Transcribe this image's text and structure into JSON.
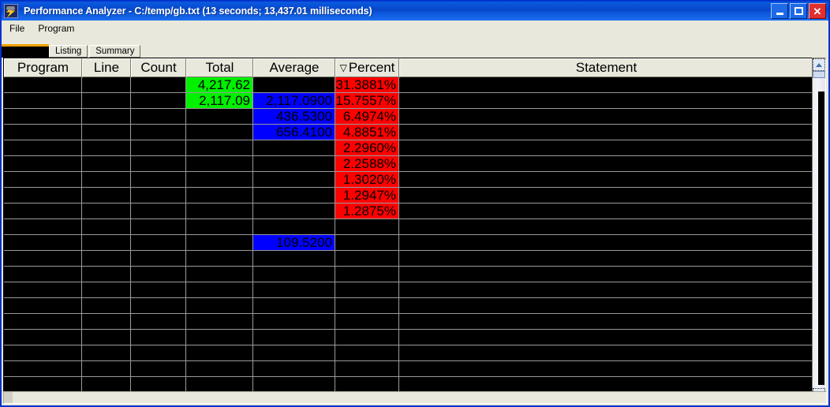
{
  "window": {
    "title": "Performance Analyzer - C:/temp/gb.txt (13 seconds; 13,437.01 milliseconds)",
    "icon": "lightning-bolt-icon",
    "buttons": {
      "minimize": "_",
      "maximize": "□",
      "close": "✕"
    }
  },
  "menu": {
    "items": [
      {
        "label": "File"
      },
      {
        "label": "Program"
      }
    ]
  },
  "tabs": [
    {
      "label": "Listing",
      "selected": false
    },
    {
      "label": "Summary",
      "selected": false
    }
  ],
  "table": {
    "columns": [
      {
        "key": "program",
        "label": "Program",
        "sorted": false
      },
      {
        "key": "line",
        "label": "Line",
        "sorted": false
      },
      {
        "key": "count",
        "label": "Count",
        "sorted": false
      },
      {
        "key": "total",
        "label": "Total",
        "sorted": false
      },
      {
        "key": "average",
        "label": "Average",
        "sorted": false
      },
      {
        "key": "percent",
        "label": "Percent",
        "sorted": true,
        "sort_indicator": "▽"
      },
      {
        "key": "statement",
        "label": "Statement",
        "sorted": false
      }
    ],
    "rows": [
      {
        "program": "",
        "line": "",
        "count": "",
        "total": "4,217.62",
        "total_bg": "#00f000",
        "average": "",
        "average_bg": "#000000",
        "percent": "31.3881%",
        "percent_bg": "#ff0000",
        "statement": ""
      },
      {
        "program": "",
        "line": "",
        "count": "",
        "total": "2,117.09",
        "total_bg": "#00f000",
        "average": "2,117.0900",
        "average_bg": "#0000ff",
        "percent": "15.7557%",
        "percent_bg": "#ff0000",
        "statement": ""
      },
      {
        "program": "",
        "line": "",
        "count": "",
        "total": "",
        "total_bg": "#000000",
        "average": "436.5300",
        "average_bg": "#0000ff",
        "percent": "6.4974%",
        "percent_bg": "#ff0000",
        "statement": ""
      },
      {
        "program": "",
        "line": "",
        "count": "",
        "total": "",
        "total_bg": "#000000",
        "average": "656.4100",
        "average_bg": "#0000ff",
        "percent": "4.8851%",
        "percent_bg": "#ff0000",
        "statement": ""
      },
      {
        "program": "",
        "line": "",
        "count": "",
        "total": "",
        "total_bg": "#000000",
        "average": "",
        "average_bg": "#000000",
        "percent": "2.2960%",
        "percent_bg": "#ff0000",
        "statement": ""
      },
      {
        "program": "",
        "line": "",
        "count": "",
        "total": "",
        "total_bg": "#000000",
        "average": "",
        "average_bg": "#000000",
        "percent": "2.2588%",
        "percent_bg": "#ff0000",
        "statement": ""
      },
      {
        "program": "",
        "line": "",
        "count": "",
        "total": "",
        "total_bg": "#000000",
        "average": "",
        "average_bg": "#000000",
        "percent": "1.3020%",
        "percent_bg": "#ff0000",
        "statement": ""
      },
      {
        "program": "",
        "line": "",
        "count": "",
        "total": "",
        "total_bg": "#000000",
        "average": "",
        "average_bg": "#000000",
        "percent": "1.2947%",
        "percent_bg": "#ff0000",
        "statement": ""
      },
      {
        "program": "",
        "line": "",
        "count": "",
        "total": "",
        "total_bg": "#000000",
        "average": "",
        "average_bg": "#000000",
        "percent": "1.2875%",
        "percent_bg": "#ff0000",
        "statement": ""
      },
      {
        "program": "",
        "line": "",
        "count": "",
        "total": "",
        "total_bg": "#000000",
        "average": "",
        "average_bg": "#000000",
        "percent": "",
        "percent_bg": "#000000",
        "statement": ""
      },
      {
        "program": "",
        "line": "",
        "count": "",
        "total": "",
        "total_bg": "#000000",
        "average": "109.5200",
        "average_bg": "#0000ff",
        "percent": "",
        "percent_bg": "#000000",
        "statement": ""
      },
      {
        "program": "",
        "line": "",
        "count": "",
        "total": "",
        "total_bg": "#000000",
        "average": "",
        "average_bg": "#000000",
        "percent": "",
        "percent_bg": "#000000",
        "statement": ""
      },
      {
        "program": "",
        "line": "",
        "count": "",
        "total": "",
        "total_bg": "#000000",
        "average": "",
        "average_bg": "#000000",
        "percent": "",
        "percent_bg": "#000000",
        "statement": ""
      },
      {
        "program": "",
        "line": "",
        "count": "",
        "total": "",
        "total_bg": "#000000",
        "average": "",
        "average_bg": "#000000",
        "percent": "",
        "percent_bg": "#000000",
        "statement": ""
      },
      {
        "program": "",
        "line": "",
        "count": "",
        "total": "",
        "total_bg": "#000000",
        "average": "",
        "average_bg": "#000000",
        "percent": "",
        "percent_bg": "#000000",
        "statement": ""
      },
      {
        "program": "",
        "line": "",
        "count": "",
        "total": "",
        "total_bg": "#000000",
        "average": "",
        "average_bg": "#000000",
        "percent": "",
        "percent_bg": "#000000",
        "statement": ""
      },
      {
        "program": "",
        "line": "",
        "count": "",
        "total": "",
        "total_bg": "#000000",
        "average": "",
        "average_bg": "#000000",
        "percent": "",
        "percent_bg": "#000000",
        "statement": ""
      },
      {
        "program": "",
        "line": "",
        "count": "",
        "total": "",
        "total_bg": "#000000",
        "average": "",
        "average_bg": "#000000",
        "percent": "",
        "percent_bg": "#000000",
        "statement": ""
      },
      {
        "program": "",
        "line": "",
        "count": "",
        "total": "",
        "total_bg": "#000000",
        "average": "",
        "average_bg": "#000000",
        "percent": "",
        "percent_bg": "#000000",
        "statement": ""
      },
      {
        "program": "",
        "line": "",
        "count": "",
        "total": "",
        "total_bg": "#000000",
        "average": "",
        "average_bg": "#000000",
        "percent": "",
        "percent_bg": "#000000",
        "statement": ""
      }
    ]
  },
  "scrollbar": {
    "up_arrow": "▲",
    "down_arrow": "▼"
  },
  "colors": {
    "accent_green": "#00f000",
    "accent_blue": "#0000ff",
    "accent_red": "#ff0000",
    "titlebar_blue": "#0a53d8",
    "grid_background": "#000000",
    "grid_line": "#9a9a9a",
    "chrome": "#e8e8dc"
  }
}
